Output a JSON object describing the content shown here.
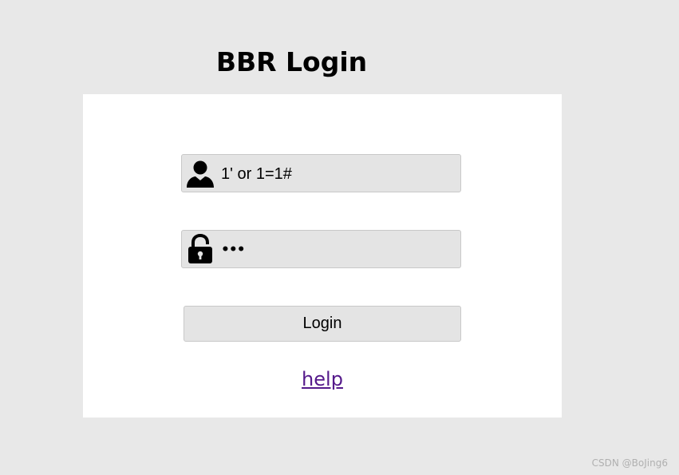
{
  "page": {
    "title": "BBR Login"
  },
  "form": {
    "username": {
      "value": "1' or 1=1#",
      "icon": "user-icon"
    },
    "password": {
      "masked_value": "•••",
      "icon": "lock-icon"
    },
    "login_label": "Login",
    "help_label": "help"
  },
  "watermark": "CSDN @BoJing6",
  "colors": {
    "background": "#e8e8e8",
    "panel": "#ffffff",
    "field": "#e4e4e4",
    "link": "#551a8b"
  }
}
